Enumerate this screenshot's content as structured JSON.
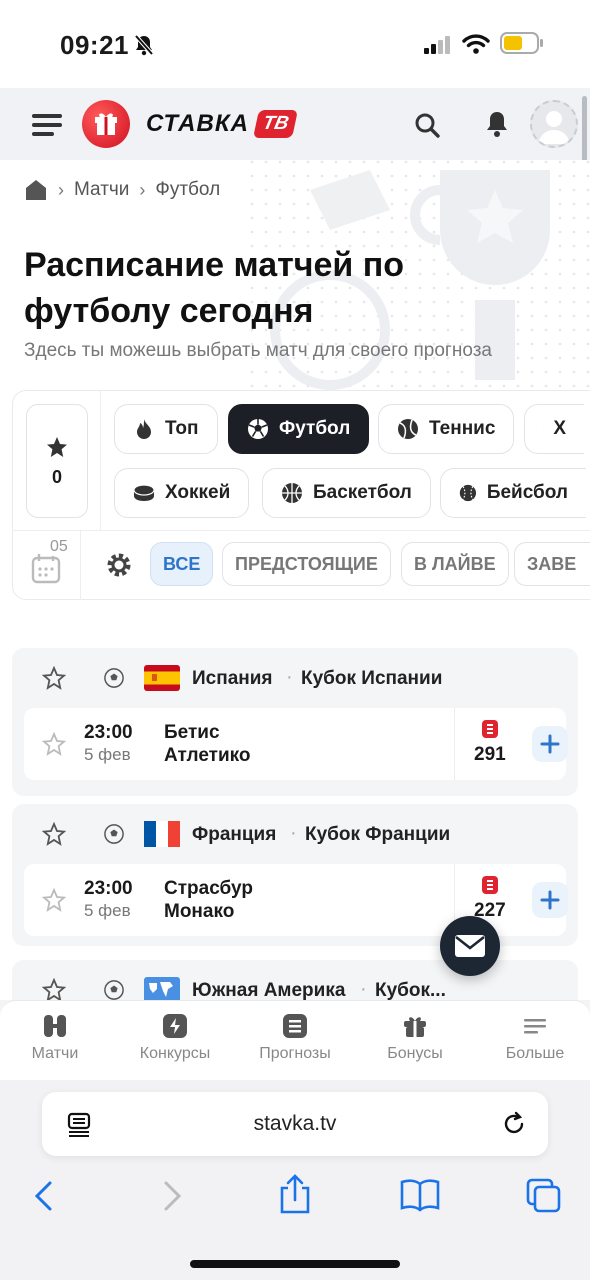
{
  "status": {
    "time": "09:21"
  },
  "header": {
    "logo_text": "СТАВКА",
    "logo_badge": "ТВ"
  },
  "breadcrumb": [
    "Матчи",
    "Футбол"
  ],
  "page": {
    "title": "Расписание матчей по футболу сегодня",
    "subtitle": "Здесь ты можешь выбрать матч для своего прогноза"
  },
  "favorites": {
    "count": "0"
  },
  "sports": [
    {
      "label": "Топ"
    },
    {
      "label": "Футбол"
    },
    {
      "label": "Теннис"
    },
    {
      "label": "Х"
    },
    {
      "label": "Хоккей"
    },
    {
      "label": "Баскетбол"
    },
    {
      "label": "Бейсбол"
    }
  ],
  "calendar": {
    "day": "05"
  },
  "filters": [
    "ВСЕ",
    "ПРЕДСТОЯЩИЕ",
    "В ЛАЙВЕ",
    "ЗАВЕ"
  ],
  "leagues": [
    {
      "country": "Испания",
      "name": "Кубок Испании",
      "match": {
        "time": "23:00",
        "date": "5 фев",
        "team1": "Бетис",
        "team2": "Атлетико",
        "count": "291"
      }
    },
    {
      "country": "Франция",
      "name": "Кубок Франции",
      "match": {
        "time": "23:00",
        "date": "5 фев",
        "team1": "Страсбур",
        "team2": "Монако",
        "count": "227"
      }
    },
    {
      "country": "Южная Америка",
      "name": "Кубок..."
    }
  ],
  "nav": [
    "Матчи",
    "Конкурсы",
    "Прогнозы",
    "Бонусы",
    "Больше"
  ],
  "browser": {
    "url": "stavka.tv"
  },
  "colors": {
    "accent": "#2f74c8",
    "brand_red": "#e0242f",
    "dark": "#1c1f26"
  }
}
